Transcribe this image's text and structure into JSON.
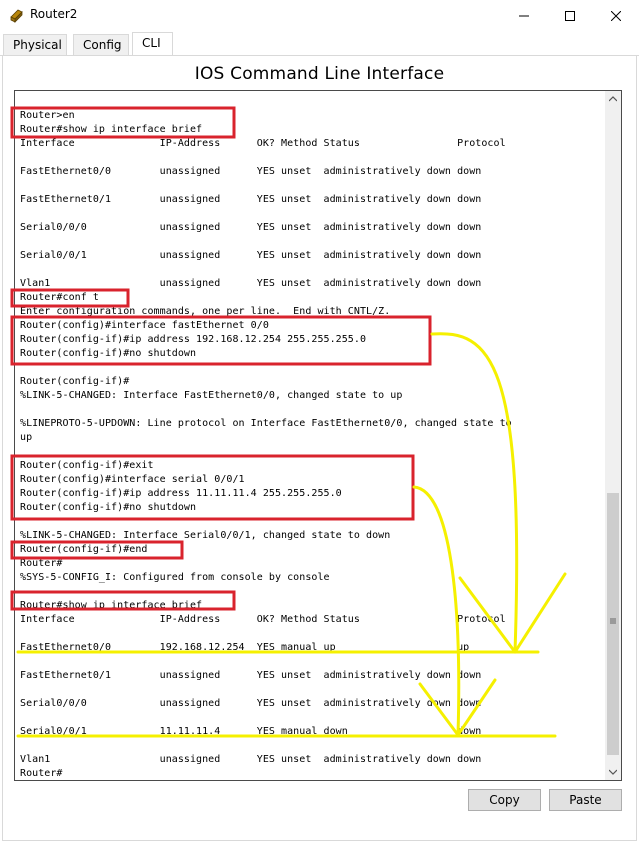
{
  "window": {
    "title": "Router2",
    "icon": "router-icon"
  },
  "tabs": [
    {
      "label": "Physical",
      "active": false
    },
    {
      "label": "Config",
      "active": false
    },
    {
      "label": "CLI",
      "active": true
    }
  ],
  "heading": "IOS Command Line Interface",
  "terminal": {
    "lines": [
      "Router>en",
      "Router#show ip interface brief",
      "Interface              IP-Address      OK? Method Status                Protocol",
      "",
      "FastEthernet0/0        unassigned      YES unset  administratively down down",
      "",
      "FastEthernet0/1        unassigned      YES unset  administratively down down",
      "",
      "Serial0/0/0            unassigned      YES unset  administratively down down",
      "",
      "Serial0/0/1            unassigned      YES unset  administratively down down",
      "",
      "Vlan1                  unassigned      YES unset  administratively down down",
      "Router#conf t",
      "Enter configuration commands, one per line.  End with CNTL/Z.",
      "Router(config)#interface fastEthernet 0/0",
      "Router(config-if)#ip address 192.168.12.254 255.255.255.0",
      "Router(config-if)#no shutdown",
      "",
      "Router(config-if)#",
      "%LINK-5-CHANGED: Interface FastEthernet0/0, changed state to up",
      "",
      "%LINEPROTO-5-UPDOWN: Line protocol on Interface FastEthernet0/0, changed state to",
      "up",
      "",
      "Router(config-if)#exit",
      "Router(config)#interface serial 0/0/1",
      "Router(config-if)#ip address 11.11.11.4 255.255.255.0",
      "Router(config-if)#no shutdown",
      "",
      "%LINK-5-CHANGED: Interface Serial0/0/1, changed state to down",
      "Router(config-if)#end",
      "Router#",
      "%SYS-5-CONFIG_I: Configured from console by console",
      "",
      "Router#show ip interface brief",
      "Interface              IP-Address      OK? Method Status                Protocol",
      "",
      "FastEthernet0/0        192.168.12.254  YES manual up                    up",
      "",
      "FastEthernet0/1        unassigned      YES unset  administratively down down",
      "",
      "Serial0/0/0            unassigned      YES unset  administratively down down",
      "",
      "Serial0/0/1            11.11.11.4      YES manual down                  down",
      "",
      "Vlan1                  unassigned      YES unset  administratively down down",
      "Router#"
    ]
  },
  "buttons": {
    "copy": "Copy",
    "paste": "Paste"
  },
  "colors": {
    "highlight_box": "#d9232d",
    "annotation": "#f5f000",
    "active_tab": "#ffffff"
  }
}
